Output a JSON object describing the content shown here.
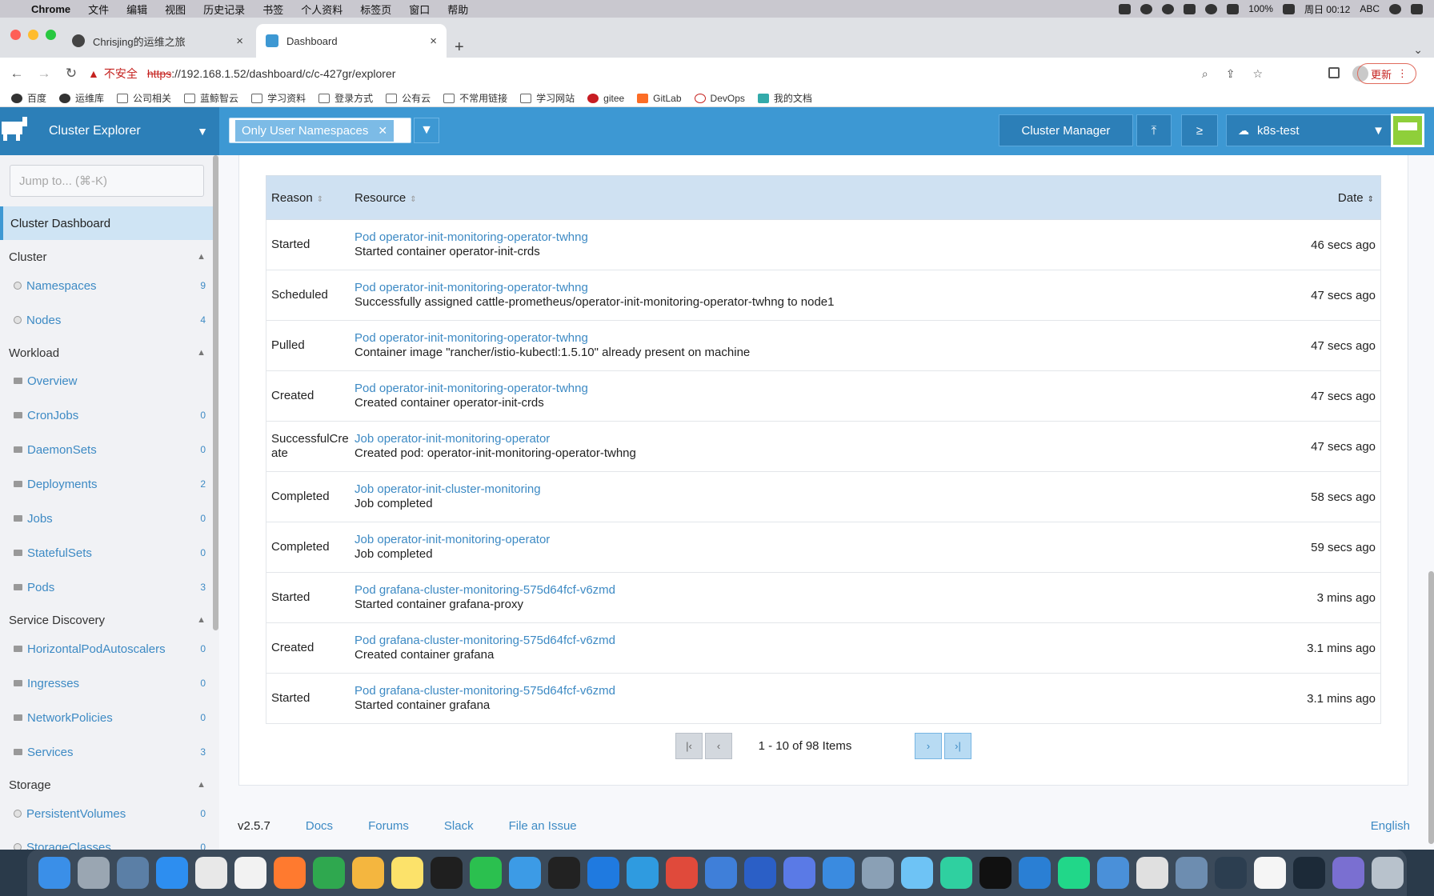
{
  "menubar": {
    "app": "Chrome",
    "items": [
      "文件",
      "编辑",
      "视图",
      "历史记录",
      "书签",
      "个人资料",
      "标签页",
      "窗口",
      "帮助"
    ],
    "battery": "100%",
    "clock": "周日 00:12",
    "input": "ABC"
  },
  "tabs": [
    {
      "title": "Chrisjing的运维之旅",
      "active": false
    },
    {
      "title": "Dashboard",
      "active": true
    }
  ],
  "address": {
    "warning": "不安全",
    "scheme": "https",
    "url_rest": "://192.168.1.52/dashboard/c/c-427gr/explorer",
    "update_label": "更新"
  },
  "bookmarks": [
    "百度",
    "运维库",
    "公司相关",
    "蓝鲸智云",
    "学习资料",
    "登录方式",
    "公有云",
    "不常用链接",
    "学习网站",
    "gitee",
    "GitLab",
    "DevOps",
    "我的文档"
  ],
  "header": {
    "product": "Cluster Explorer",
    "namespace_filter": "Only User Namespaces",
    "cluster_manager": "Cluster Manager",
    "cluster": "k8s-test"
  },
  "sidebar": {
    "jump_placeholder": "Jump to... (⌘-K)",
    "active": "Cluster Dashboard",
    "groups": [
      {
        "label": "Cluster",
        "items": [
          {
            "label": "Namespaces",
            "count": "9",
            "icon": "globe-icon"
          },
          {
            "label": "Nodes",
            "count": "4",
            "icon": "globe-icon"
          }
        ]
      },
      {
        "label": "Workload",
        "items": [
          {
            "label": "Overview",
            "count": "",
            "icon": "folder-icon"
          },
          {
            "label": "CronJobs",
            "count": "0",
            "icon": "folder-icon"
          },
          {
            "label": "DaemonSets",
            "count": "0",
            "icon": "folder-icon"
          },
          {
            "label": "Deployments",
            "count": "2",
            "icon": "folder-icon"
          },
          {
            "label": "Jobs",
            "count": "0",
            "icon": "folder-icon"
          },
          {
            "label": "StatefulSets",
            "count": "0",
            "icon": "folder-icon"
          },
          {
            "label": "Pods",
            "count": "3",
            "icon": "folder-icon"
          }
        ]
      },
      {
        "label": "Service Discovery",
        "items": [
          {
            "label": "HorizontalPodAutoscalers",
            "count": "0",
            "icon": "folder-icon"
          },
          {
            "label": "Ingresses",
            "count": "0",
            "icon": "folder-icon"
          },
          {
            "label": "NetworkPolicies",
            "count": "0",
            "icon": "folder-icon"
          },
          {
            "label": "Services",
            "count": "3",
            "icon": "folder-icon"
          }
        ]
      },
      {
        "label": "Storage",
        "items": [
          {
            "label": "PersistentVolumes",
            "count": "0",
            "icon": "globe-icon"
          },
          {
            "label": "StorageClasses",
            "count": "0",
            "icon": "globe-icon"
          }
        ]
      }
    ]
  },
  "events": {
    "columns": {
      "reason": "Reason",
      "resource": "Resource",
      "date": "Date"
    },
    "rows": [
      {
        "reason": "Started",
        "resource": "Pod operator-init-monitoring-operator-twhng",
        "message": "Started container operator-init-crds",
        "date": "46 secs ago"
      },
      {
        "reason": "Scheduled",
        "resource": "Pod operator-init-monitoring-operator-twhng",
        "message": "Successfully assigned cattle-prometheus/operator-init-monitoring-operator-twhng to node1",
        "date": "47 secs ago"
      },
      {
        "reason": "Pulled",
        "resource": "Pod operator-init-monitoring-operator-twhng",
        "message": "Container image \"rancher/istio-kubectl:1.5.10\" already present on machine",
        "date": "47 secs ago"
      },
      {
        "reason": "Created",
        "resource": "Pod operator-init-monitoring-operator-twhng",
        "message": "Created container operator-init-crds",
        "date": "47 secs ago"
      },
      {
        "reason": "SuccessfulCreate",
        "resource": "Job operator-init-monitoring-operator",
        "message": "Created pod: operator-init-monitoring-operator-twhng",
        "date": "47 secs ago"
      },
      {
        "reason": "Completed",
        "resource": "Job operator-init-cluster-monitoring",
        "message": "Job completed",
        "date": "58 secs ago"
      },
      {
        "reason": "Completed",
        "resource": "Job operator-init-monitoring-operator",
        "message": "Job completed",
        "date": "59 secs ago"
      },
      {
        "reason": "Started",
        "resource": "Pod grafana-cluster-monitoring-575d64fcf-v6zmd",
        "message": "Started container grafana-proxy",
        "date": "3 mins ago"
      },
      {
        "reason": "Created",
        "resource": "Pod grafana-cluster-monitoring-575d64fcf-v6zmd",
        "message": "Created container grafana",
        "date": "3.1 mins ago"
      },
      {
        "reason": "Started",
        "resource": "Pod grafana-cluster-monitoring-575d64fcf-v6zmd",
        "message": "Started container grafana",
        "date": "3.1 mins ago"
      }
    ],
    "pagination": "1 - 10 of 98 Items"
  },
  "footer": {
    "version": "v2.5.7",
    "links": [
      "Docs",
      "Forums",
      "Slack",
      "File an Issue"
    ],
    "language": "English"
  },
  "colors": {
    "primary": "#3d98d3",
    "link": "#3d8ac4",
    "header_dark": "#2c7fb8"
  }
}
